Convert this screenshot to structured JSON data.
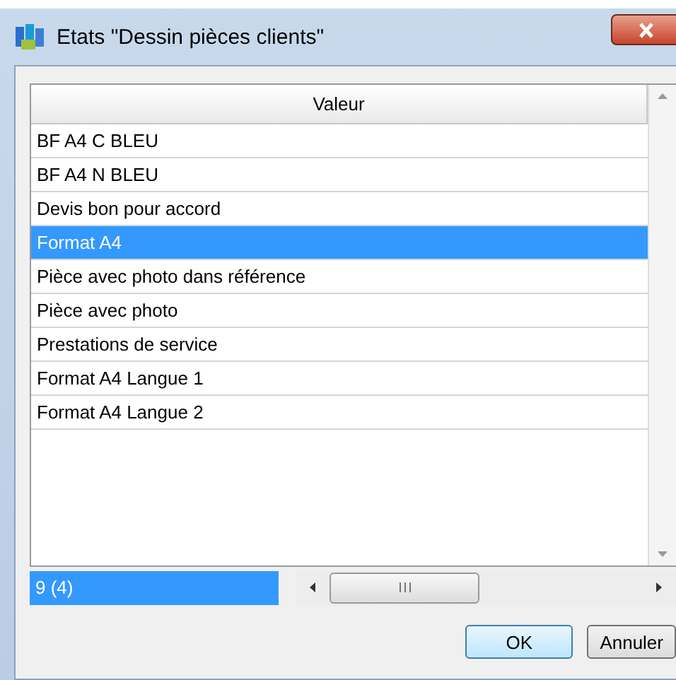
{
  "window": {
    "title": "Etats \"Dessin pièces clients\""
  },
  "table": {
    "columns": [
      "Valeur"
    ],
    "rows": [
      {
        "value": "BF A4 C BLEU",
        "selected": false
      },
      {
        "value": "BF A4 N BLEU",
        "selected": false
      },
      {
        "value": "Devis bon pour accord",
        "selected": false
      },
      {
        "value": "Format A4",
        "selected": true
      },
      {
        "value": "Pièce avec photo dans référence",
        "selected": false
      },
      {
        "value": "Pièce avec photo",
        "selected": false
      },
      {
        "value": "Prestations de service",
        "selected": false
      },
      {
        "value": "Format A4 Langue 1",
        "selected": false
      },
      {
        "value": "Format A4 Langue 2",
        "selected": false
      }
    ]
  },
  "status_bar": {
    "count": "9 (4)"
  },
  "buttons": [
    "OK",
    "Annuler"
  ]
}
